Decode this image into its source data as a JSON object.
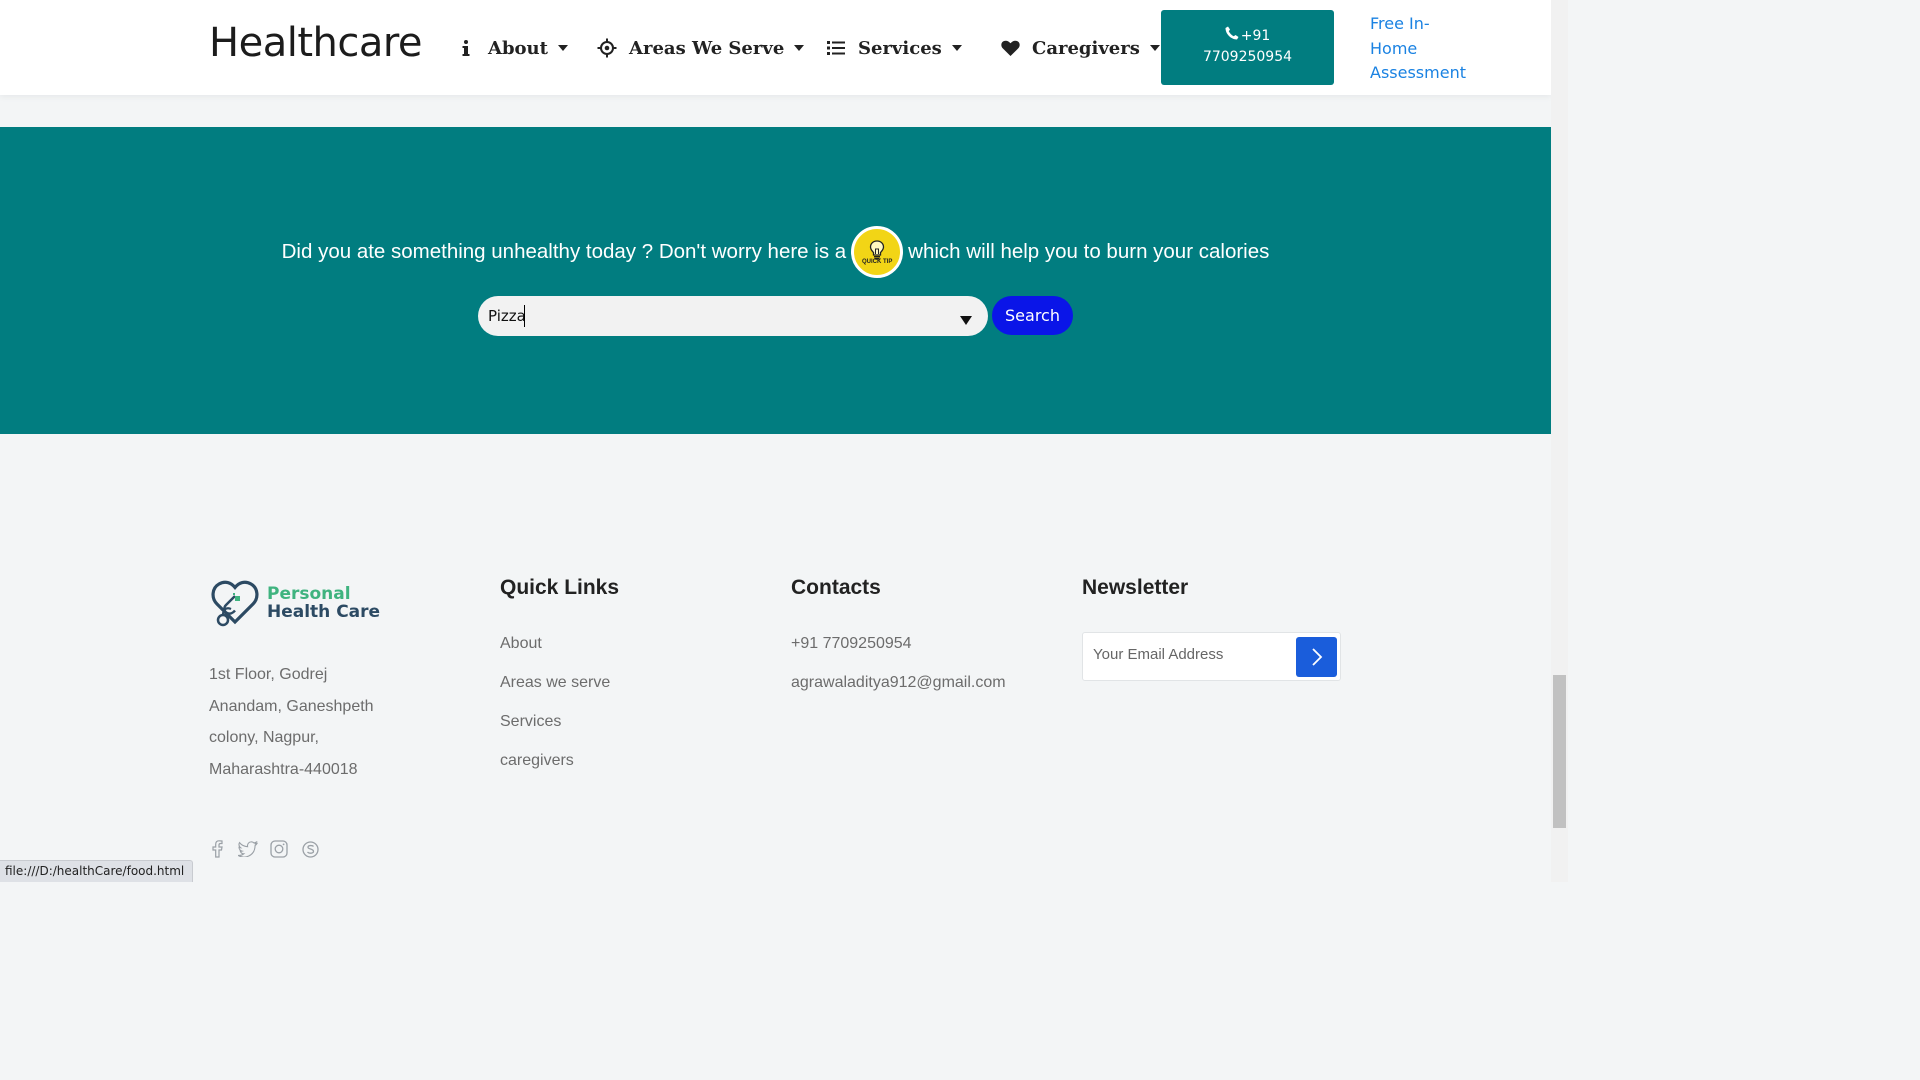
{
  "header": {
    "brand": "Healthcare",
    "nav": [
      {
        "label": "About",
        "icon": "info-icon"
      },
      {
        "label": "Areas We Serve",
        "icon": "crosshair-icon"
      },
      {
        "label": "Services",
        "icon": "list-icon"
      },
      {
        "label": "Caregivers",
        "icon": "heart-icon"
      }
    ],
    "call_line1": "+91",
    "call_line2": "7709250954",
    "assessment_link": "Free In-Home Assessment"
  },
  "tip_section": {
    "text_before": "Did you ate something unhealthy today ? Don't worry here is a",
    "badge_text": "QUICK TIP",
    "text_after": "which will help you to burn your calories",
    "search_value": "Pizza",
    "search_button": "Search"
  },
  "footer": {
    "logo_line1": "Personal",
    "logo_line2": "Health Care",
    "address": "1st Floor, Godrej Anandam, Ganeshpeth colony, Nagpur, Maharashtra-440018",
    "quick_links_title": "Quick Links",
    "quick_links": [
      "About",
      "Areas we serve",
      "Services",
      "caregivers"
    ],
    "contacts_title": "Contacts",
    "phone": "+91 7709250954",
    "email": "agrawaladitya912@gmail.com",
    "newsletter_title": "Newsletter",
    "newsletter_placeholder": "Your Email Address",
    "social": [
      "facebook-icon",
      "twitter-icon",
      "instagram-icon",
      "skype-icon"
    ]
  },
  "status_url": "file:///D:/healthCare/food.html",
  "colors": {
    "teal": "#017d80",
    "search_blue": "#0a15e8",
    "link_blue": "#1a82e2",
    "logo_green": "#3fb37f",
    "logo_navy": "#2c4a63"
  }
}
